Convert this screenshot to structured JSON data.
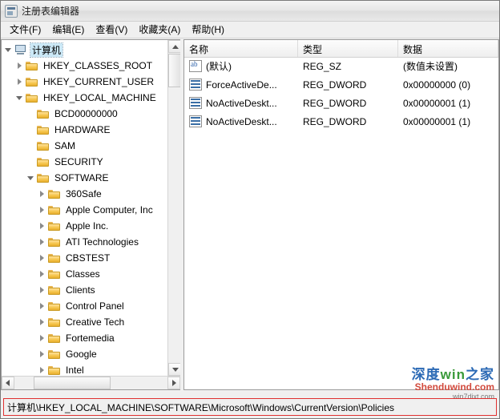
{
  "window": {
    "title": "注册表编辑器",
    "icon": "registry-editor-icon"
  },
  "menubar": {
    "items": [
      {
        "label": "文件(F)"
      },
      {
        "label": "编辑(E)"
      },
      {
        "label": "查看(V)"
      },
      {
        "label": "收藏夹(A)"
      },
      {
        "label": "帮助(H)"
      }
    ]
  },
  "tree": {
    "nodes": [
      {
        "label": "计算机",
        "indent": 0,
        "state": "expanded",
        "icon": "computer-icon"
      },
      {
        "label": "HKEY_CLASSES_ROOT",
        "indent": 1,
        "state": "collapsed",
        "icon": "folder-icon"
      },
      {
        "label": "HKEY_CURRENT_USER",
        "indent": 1,
        "state": "collapsed",
        "icon": "folder-icon"
      },
      {
        "label": "HKEY_LOCAL_MACHINE",
        "indent": 1,
        "state": "expanded",
        "icon": "folder-icon"
      },
      {
        "label": "BCD00000000",
        "indent": 2,
        "state": "none",
        "icon": "folder-icon"
      },
      {
        "label": "HARDWARE",
        "indent": 2,
        "state": "none",
        "icon": "folder-icon"
      },
      {
        "label": "SAM",
        "indent": 2,
        "state": "none",
        "icon": "folder-icon"
      },
      {
        "label": "SECURITY",
        "indent": 2,
        "state": "none",
        "icon": "folder-icon"
      },
      {
        "label": "SOFTWARE",
        "indent": 2,
        "state": "expanded",
        "icon": "folder-icon"
      },
      {
        "label": "360Safe",
        "indent": 3,
        "state": "collapsed",
        "icon": "folder-icon"
      },
      {
        "label": "Apple Computer, Inc",
        "indent": 3,
        "state": "collapsed",
        "icon": "folder-icon"
      },
      {
        "label": "Apple Inc.",
        "indent": 3,
        "state": "collapsed",
        "icon": "folder-icon"
      },
      {
        "label": "ATI Technologies",
        "indent": 3,
        "state": "collapsed",
        "icon": "folder-icon"
      },
      {
        "label": "CBSTEST",
        "indent": 3,
        "state": "collapsed",
        "icon": "folder-icon"
      },
      {
        "label": "Classes",
        "indent": 3,
        "state": "collapsed",
        "icon": "folder-icon"
      },
      {
        "label": "Clients",
        "indent": 3,
        "state": "collapsed",
        "icon": "folder-icon"
      },
      {
        "label": "Control Panel",
        "indent": 3,
        "state": "collapsed",
        "icon": "folder-icon"
      },
      {
        "label": "Creative Tech",
        "indent": 3,
        "state": "collapsed",
        "icon": "folder-icon"
      },
      {
        "label": "Fortemedia",
        "indent": 3,
        "state": "collapsed",
        "icon": "folder-icon"
      },
      {
        "label": "Google",
        "indent": 3,
        "state": "collapsed",
        "icon": "folder-icon"
      },
      {
        "label": "Intel",
        "indent": 3,
        "state": "collapsed",
        "icon": "folder-icon"
      }
    ]
  },
  "list": {
    "columns": [
      {
        "label": "名称"
      },
      {
        "label": "类型"
      },
      {
        "label": "数据"
      }
    ],
    "rows": [
      {
        "name": "(默认)",
        "type": "REG_SZ",
        "data": "(数值未设置)",
        "icon": "string-value-icon"
      },
      {
        "name": "ForceActiveDe...",
        "type": "REG_DWORD",
        "data": "0x00000000 (0)",
        "icon": "binary-value-icon"
      },
      {
        "name": "NoActiveDeskt...",
        "type": "REG_DWORD",
        "data": "0x00000001 (1)",
        "icon": "binary-value-icon"
      },
      {
        "name": "NoActiveDeskt...",
        "type": "REG_DWORD",
        "data": "0x00000001 (1)",
        "icon": "binary-value-icon"
      }
    ]
  },
  "statusbar": {
    "path": "计算机\\HKEY_LOCAL_MACHINE\\SOFTWARE\\Microsoft\\Windows\\CurrentVersion\\Policies"
  },
  "watermark": {
    "cn_part1": "深度",
    "cn_part2": "win",
    "cn_part3": "之家",
    "en": "Shenduwind.com",
    "sub": "win7djxt.com",
    "color_blue": "#2c6ab5",
    "color_green": "#3a9a3a",
    "color_red": "#d24a3d"
  }
}
